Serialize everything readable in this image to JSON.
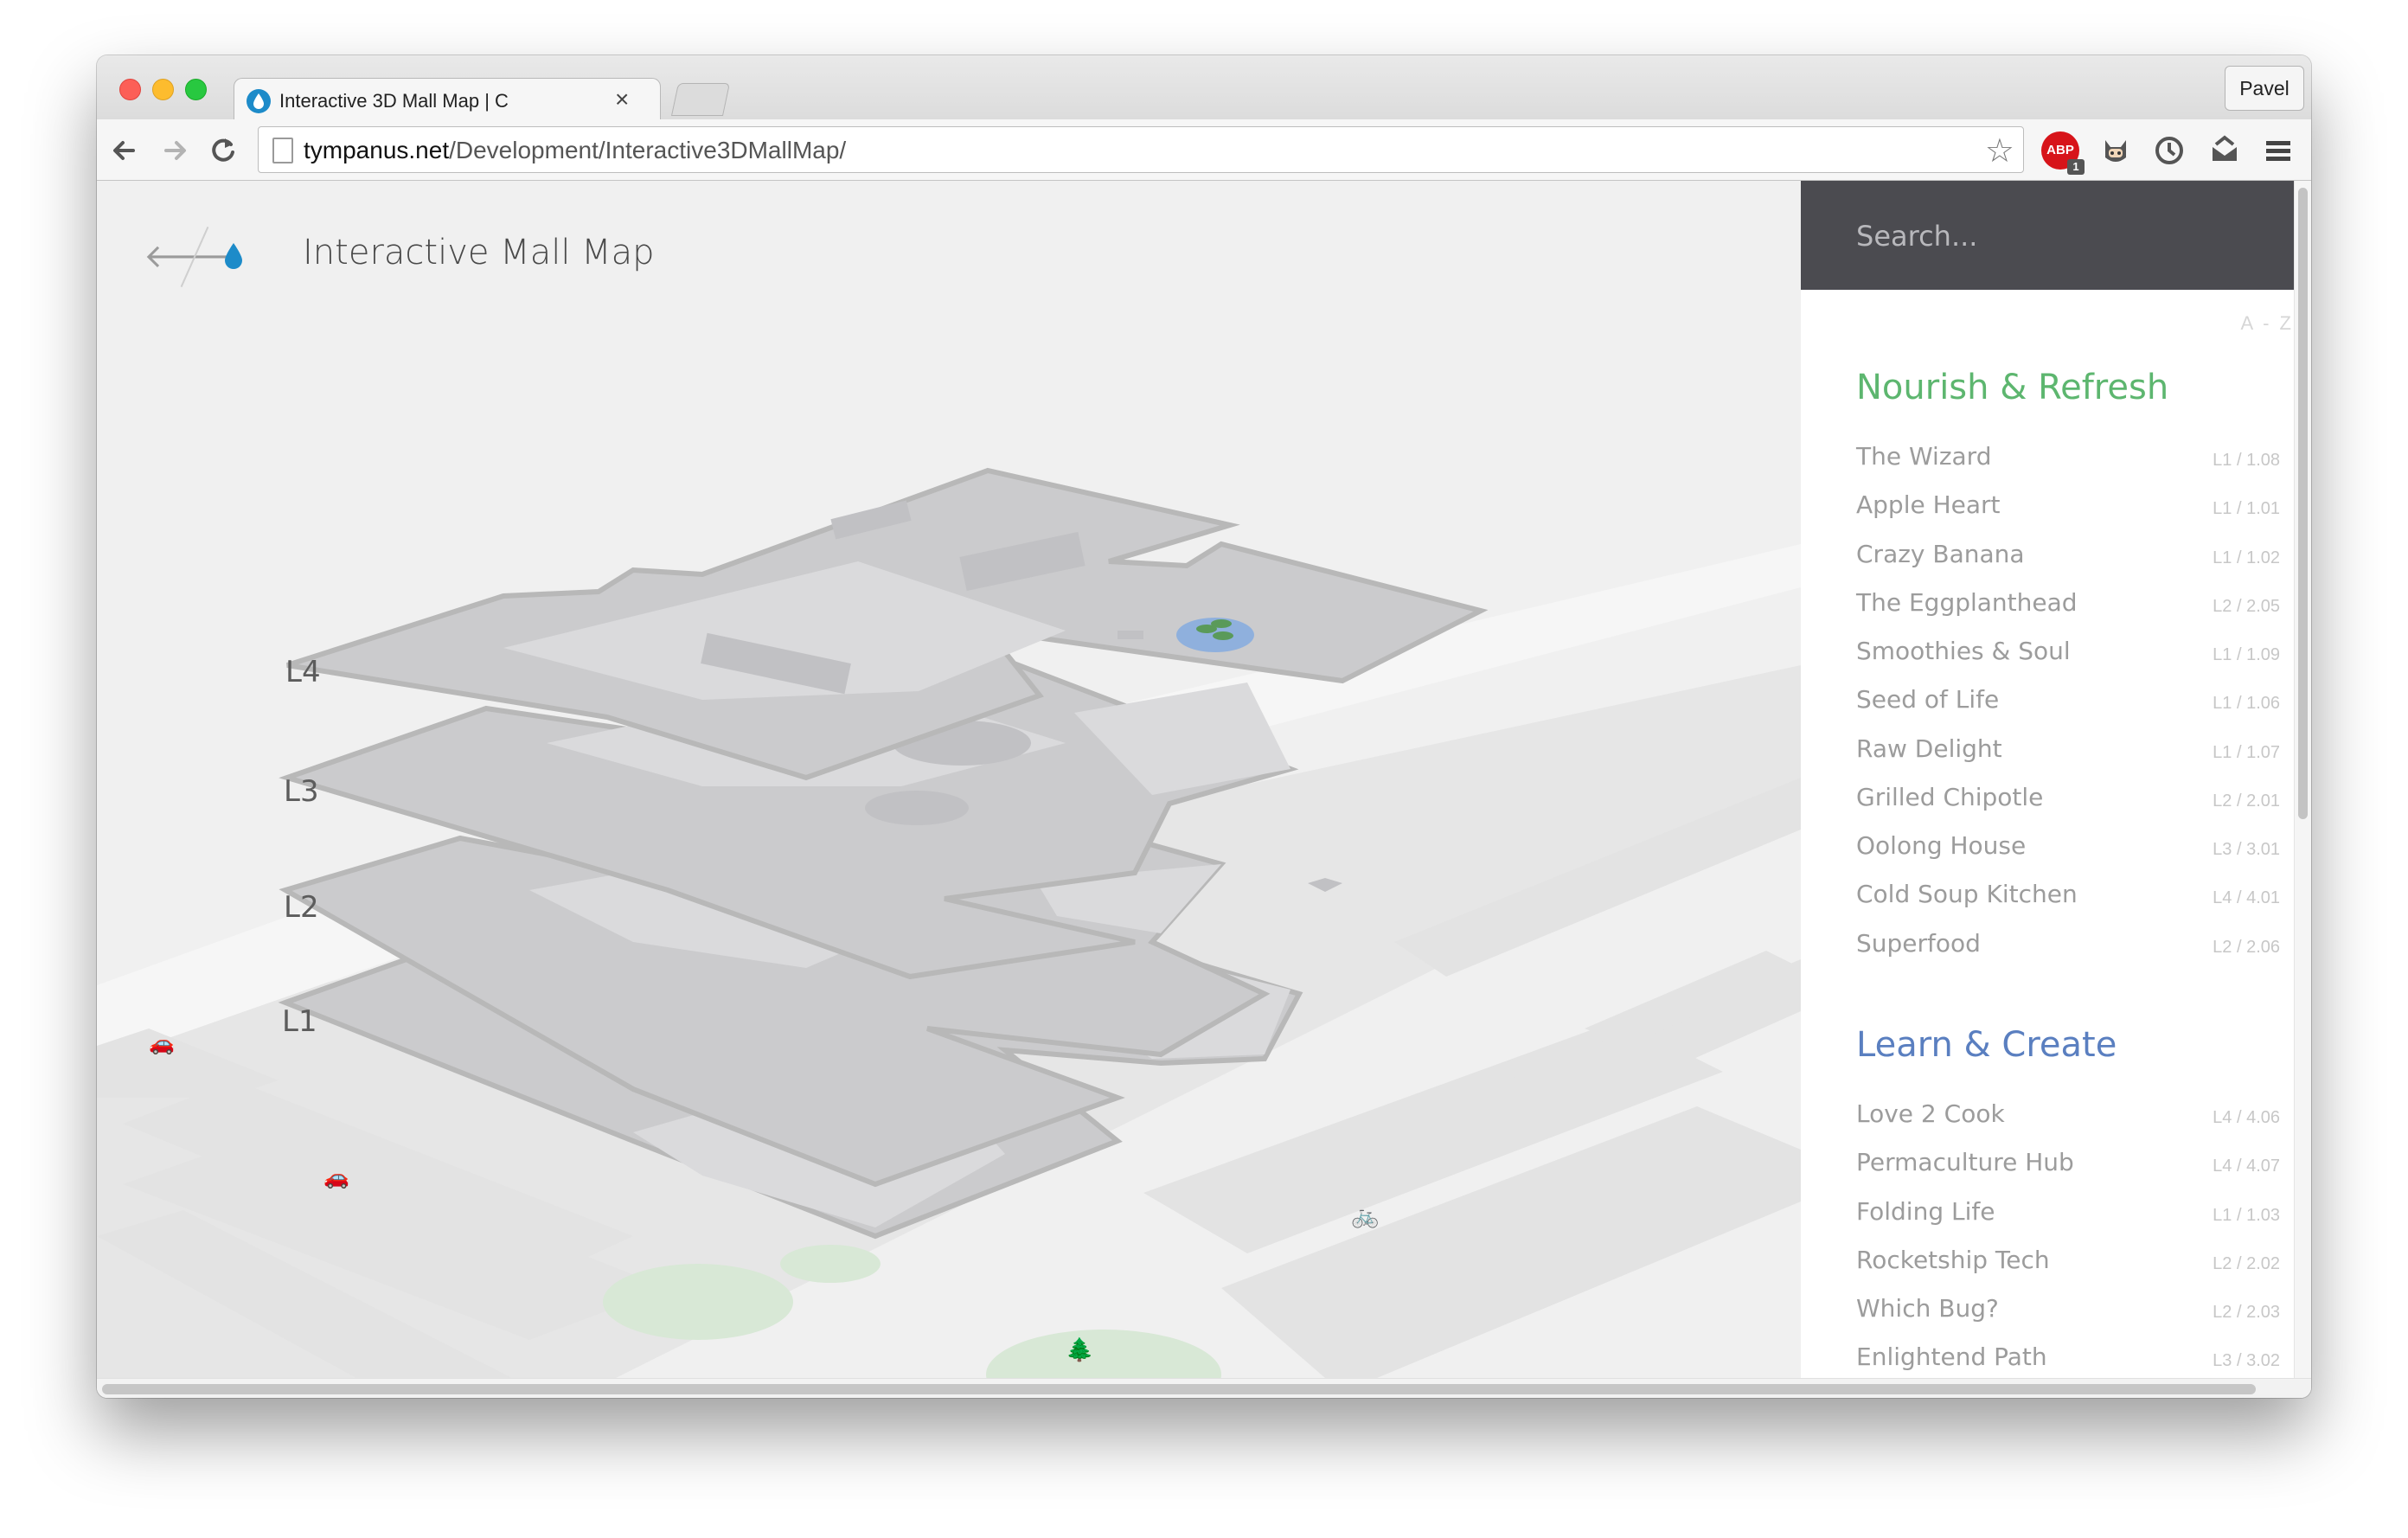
{
  "browser": {
    "tab_title": "Interactive 3D Mall Map | C",
    "profile_name": "Pavel",
    "url_host": "tympanus.net",
    "url_path": "/Development/Interactive3DMallMap/",
    "extensions": [
      "adblock-plus-icon",
      "octocat-icon",
      "sync-icon",
      "mail-icon",
      "menu-icon"
    ],
    "adblock_label": "ABP",
    "adblock_badge": "1"
  },
  "page": {
    "title": "Interactive Mall Map",
    "levels": [
      "L4",
      "L3",
      "L2",
      "L1"
    ]
  },
  "sidebar": {
    "search_placeholder": "Search...",
    "sort_label": "A - Z",
    "categories": [
      {
        "title": "Nourish & Refresh",
        "color": "#5db66f",
        "stores": [
          {
            "name": "The Wizard",
            "loc": "L1 / 1.08"
          },
          {
            "name": "Apple Heart",
            "loc": "L1 / 1.01"
          },
          {
            "name": "Crazy Banana",
            "loc": "L1 / 1.02"
          },
          {
            "name": "The Eggplanthead",
            "loc": "L2 / 2.05"
          },
          {
            "name": "Smoothies & Soul",
            "loc": "L1 / 1.09"
          },
          {
            "name": "Seed of Life",
            "loc": "L1 / 1.06"
          },
          {
            "name": "Raw Delight",
            "loc": "L1 / 1.07"
          },
          {
            "name": "Grilled Chipotle",
            "loc": "L2 / 2.01"
          },
          {
            "name": "Oolong House",
            "loc": "L3 / 3.01"
          },
          {
            "name": "Cold Soup Kitchen",
            "loc": "L4 / 4.01"
          },
          {
            "name": "Superfood",
            "loc": "L2 / 2.06"
          }
        ]
      },
      {
        "title": "Learn & Create",
        "color": "#5a7fc0",
        "stores": [
          {
            "name": "Love 2 Cook",
            "loc": "L4 / 4.06"
          },
          {
            "name": "Permaculture Hub",
            "loc": "L4 / 4.07"
          },
          {
            "name": "Folding Life",
            "loc": "L1 / 1.03"
          },
          {
            "name": "Rocketship Tech",
            "loc": "L2 / 2.02"
          },
          {
            "name": "Which Bug?",
            "loc": "L2 / 2.03"
          },
          {
            "name": "Enlightend Path",
            "loc": "L3 / 3.02"
          }
        ]
      }
    ]
  }
}
